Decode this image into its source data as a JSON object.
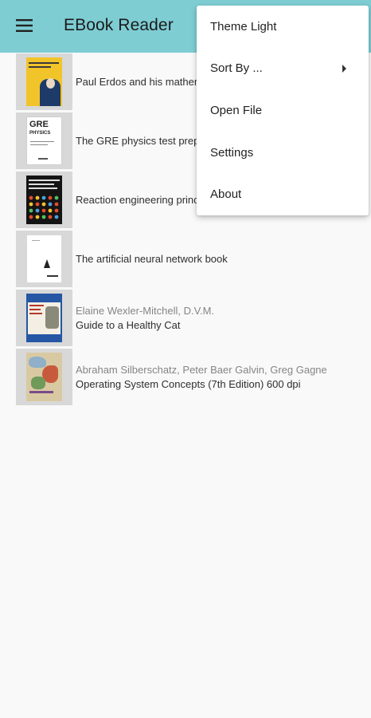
{
  "app_bar": {
    "title": "EBook Reader",
    "background": "#7ecdd3",
    "menu_icon": "hamburger-menu-icon"
  },
  "books": [
    {
      "author": "",
      "title": "Paul Erdos and his mathematics",
      "cover_icon": "book-cover-erdos"
    },
    {
      "author": "",
      "title": "The GRE physics test preparation",
      "cover_icon": "book-cover-gre-physics"
    },
    {
      "author": "",
      "title": "Reaction engineering principles",
      "cover_icon": "book-cover-reaction-engineering"
    },
    {
      "author": "",
      "title": "The artificial neural network book",
      "cover_icon": "book-cover-neural-network"
    },
    {
      "author": "Elaine Wexler-Mitchell, D.V.M.",
      "title": "Guide to a Healthy Cat",
      "cover_icon": "book-cover-healthy-cat"
    },
    {
      "author": "Abraham Silberschatz, Peter Baer Galvin, Greg Gagne",
      "title": "Operating System Concepts (7th Edition) 600 dpi",
      "cover_icon": "book-cover-os-concepts"
    }
  ],
  "overflow_menu": {
    "items": [
      {
        "label": "Theme Light"
      },
      {
        "label": "Sort By ...",
        "submenu_icon": "chevron-right-icon"
      },
      {
        "label": "Open File"
      },
      {
        "label": "Settings"
      },
      {
        "label": "About"
      }
    ]
  },
  "covers": {
    "erdos_title": "PAUL ERDOS",
    "gre_title": "GRE",
    "gre_subtitle": "PHYSICS",
    "reaction_title": "REACTION ENGINEERING PRINCIPLES",
    "cat_title": "GUIDE TO A HEALTHY CAT",
    "os_title": "Operating System Concepts"
  }
}
